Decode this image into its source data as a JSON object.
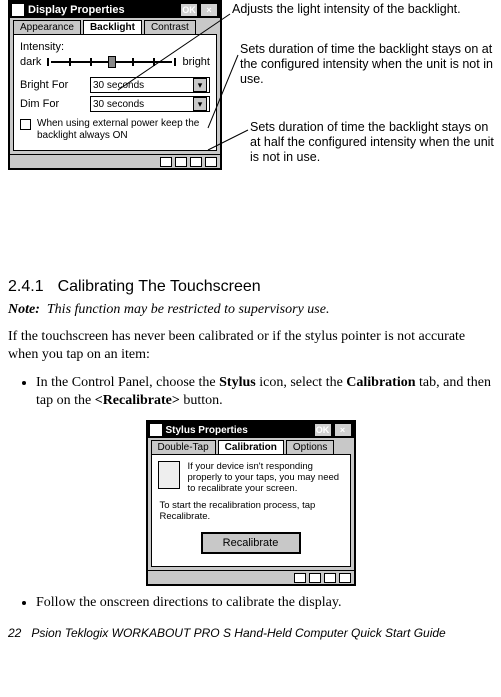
{
  "display_window": {
    "title": "Display Properties",
    "ok": "OK",
    "close": "×",
    "tabs": {
      "appearance": "Appearance",
      "backlight": "Backlight",
      "contrast": "Contrast"
    },
    "intensity_label": "Intensity:",
    "dark": "dark",
    "bright": "bright",
    "bright_for": "Bright For",
    "dim_for": "Dim For",
    "bright_for_value": "30 seconds",
    "dim_for_value": "30 seconds",
    "checkbox_label": "When using external power keep the backlight always ON"
  },
  "callouts": {
    "c1": "Adjusts the light intensity of the backlight.",
    "c2": "Sets duration of time the backlight stays on at the configured intensity when the unit is not in use.",
    "c3": "Sets duration of time the backlight stays on at half the configured intensity when the unit is not in use."
  },
  "section": {
    "number": "2.4.1",
    "title": "Calibrating The Touchscreen"
  },
  "note": {
    "label": "Note:",
    "text": "This function may be restricted to supervisory use."
  },
  "para1": "If the touchscreen has never been calibrated or if the stylus pointer is not accurate when you tap on an item:",
  "step1_a": "In the Control Panel, choose the ",
  "step1_b": "Stylus",
  "step1_c": " icon, select the ",
  "step1_d": "Calibration",
  "step1_e": " tab, and then tap on the ",
  "step1_f": "<Recalibrate>",
  "step1_g": " button.",
  "stylus_window": {
    "title": "Stylus Properties",
    "ok": "OK",
    "close": "×",
    "tabs": {
      "doubletap": "Double-Tap",
      "calibration": "Calibration",
      "options": "Options"
    },
    "msg1": "If your device isn't responding properly to your taps, you may need to recalibrate your screen.",
    "msg2": "To start the recalibration process, tap Recalibrate.",
    "button": "Recalibrate"
  },
  "step2": "Follow the onscreen directions to calibrate the display.",
  "footer": {
    "page": "22",
    "text": "Psion Teklogix WORKABOUT PRO  S Hand-Held Computer Quick Start Guide"
  }
}
